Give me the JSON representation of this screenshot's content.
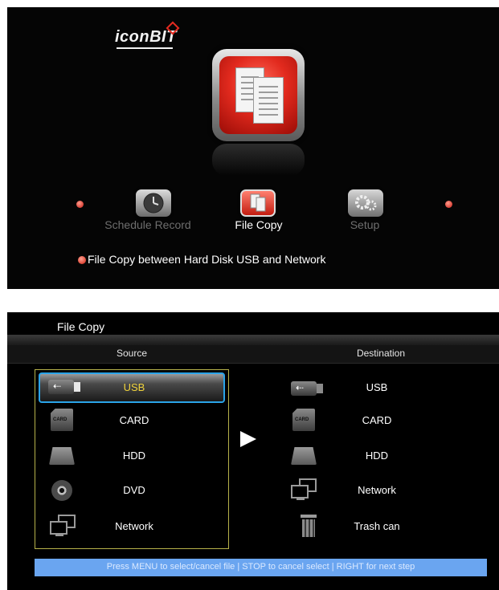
{
  "top_menu": {
    "brand": "iconBIT",
    "items": [
      {
        "label": "Schedule Record",
        "icon": "clock-icon",
        "selected": false
      },
      {
        "label": "File Copy",
        "icon": "file-copy-icon",
        "selected": true
      },
      {
        "label": "Setup",
        "icon": "gears-icon",
        "selected": false
      }
    ],
    "description": "File Copy between Hard Disk USB and Network"
  },
  "file_copy": {
    "title": "File Copy",
    "source_header": "Source",
    "destination_header": "Destination",
    "source_items": [
      {
        "label": "USB",
        "icon": "usb-icon",
        "selected": true
      },
      {
        "label": "CARD",
        "icon": "card-icon",
        "selected": false
      },
      {
        "label": "HDD",
        "icon": "hdd-icon",
        "selected": false
      },
      {
        "label": "DVD",
        "icon": "dvd-icon",
        "selected": false
      },
      {
        "label": "Network",
        "icon": "network-icon",
        "selected": false
      }
    ],
    "destination_items": [
      {
        "label": "USB",
        "icon": "usb-icon"
      },
      {
        "label": "CARD",
        "icon": "card-icon"
      },
      {
        "label": "HDD",
        "icon": "hdd-icon"
      },
      {
        "label": "Network",
        "icon": "network-icon"
      },
      {
        "label": "Trash can",
        "icon": "trash-icon"
      }
    ],
    "help_text": "Press MENU to select/cancel file | STOP to cancel select | RIGHT for next step"
  },
  "colors": {
    "accent_red": "#e22a1e",
    "selection_yellow": "#f0d33c",
    "highlight_blue": "#2aa4e8",
    "help_bar": "#6aa5f0"
  }
}
